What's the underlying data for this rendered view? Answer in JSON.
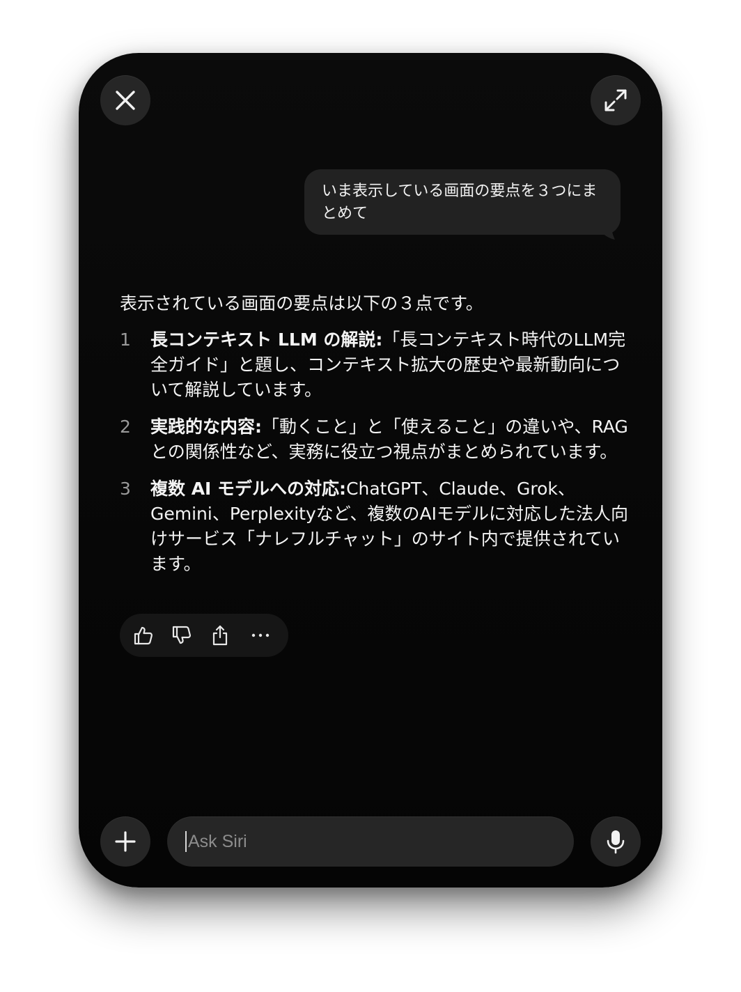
{
  "window": {
    "close_icon": "close-icon",
    "expand_icon": "expand-icon"
  },
  "conversation": {
    "user_message": "いま表示している画面の要点を３つにまとめて",
    "response_intro": "表示されている画面の要点は以下の３点です。",
    "points": [
      {
        "number": "1",
        "title": "長コンテキスト LLM の解説:",
        "text": "「長コンテキスト時代のLLM完全ガイド」と題し、コンテキスト拡大の歴史や最新動向について解説しています。"
      },
      {
        "number": "2",
        "title": "実践的な内容:",
        "text": "「動くこと」と「使えること」の違いや、RAGとの関係性など、実務に役立つ視点がまとめられています。"
      },
      {
        "number": "3",
        "title": "複数 AI モデルへの対応:",
        "text": "ChatGPT、Claude、Grok、Gemini、Perplexityなど、複数のAIモデルに対応した法人向けサービス「ナレフルチャット」のサイト内で提供されています。"
      }
    ],
    "actions": [
      "thumbs-up-icon",
      "thumbs-down-icon",
      "share-icon",
      "more-icon"
    ]
  },
  "composer": {
    "placeholder": "Ask Siri",
    "add_icon": "plus-icon",
    "mic_icon": "microphone-icon"
  },
  "colors": {
    "panel_background": "#080808",
    "control_background": "#262626",
    "bubble_background": "#222222",
    "text_primary": "#f4f4f4",
    "text_secondary": "#9a9a9a"
  }
}
